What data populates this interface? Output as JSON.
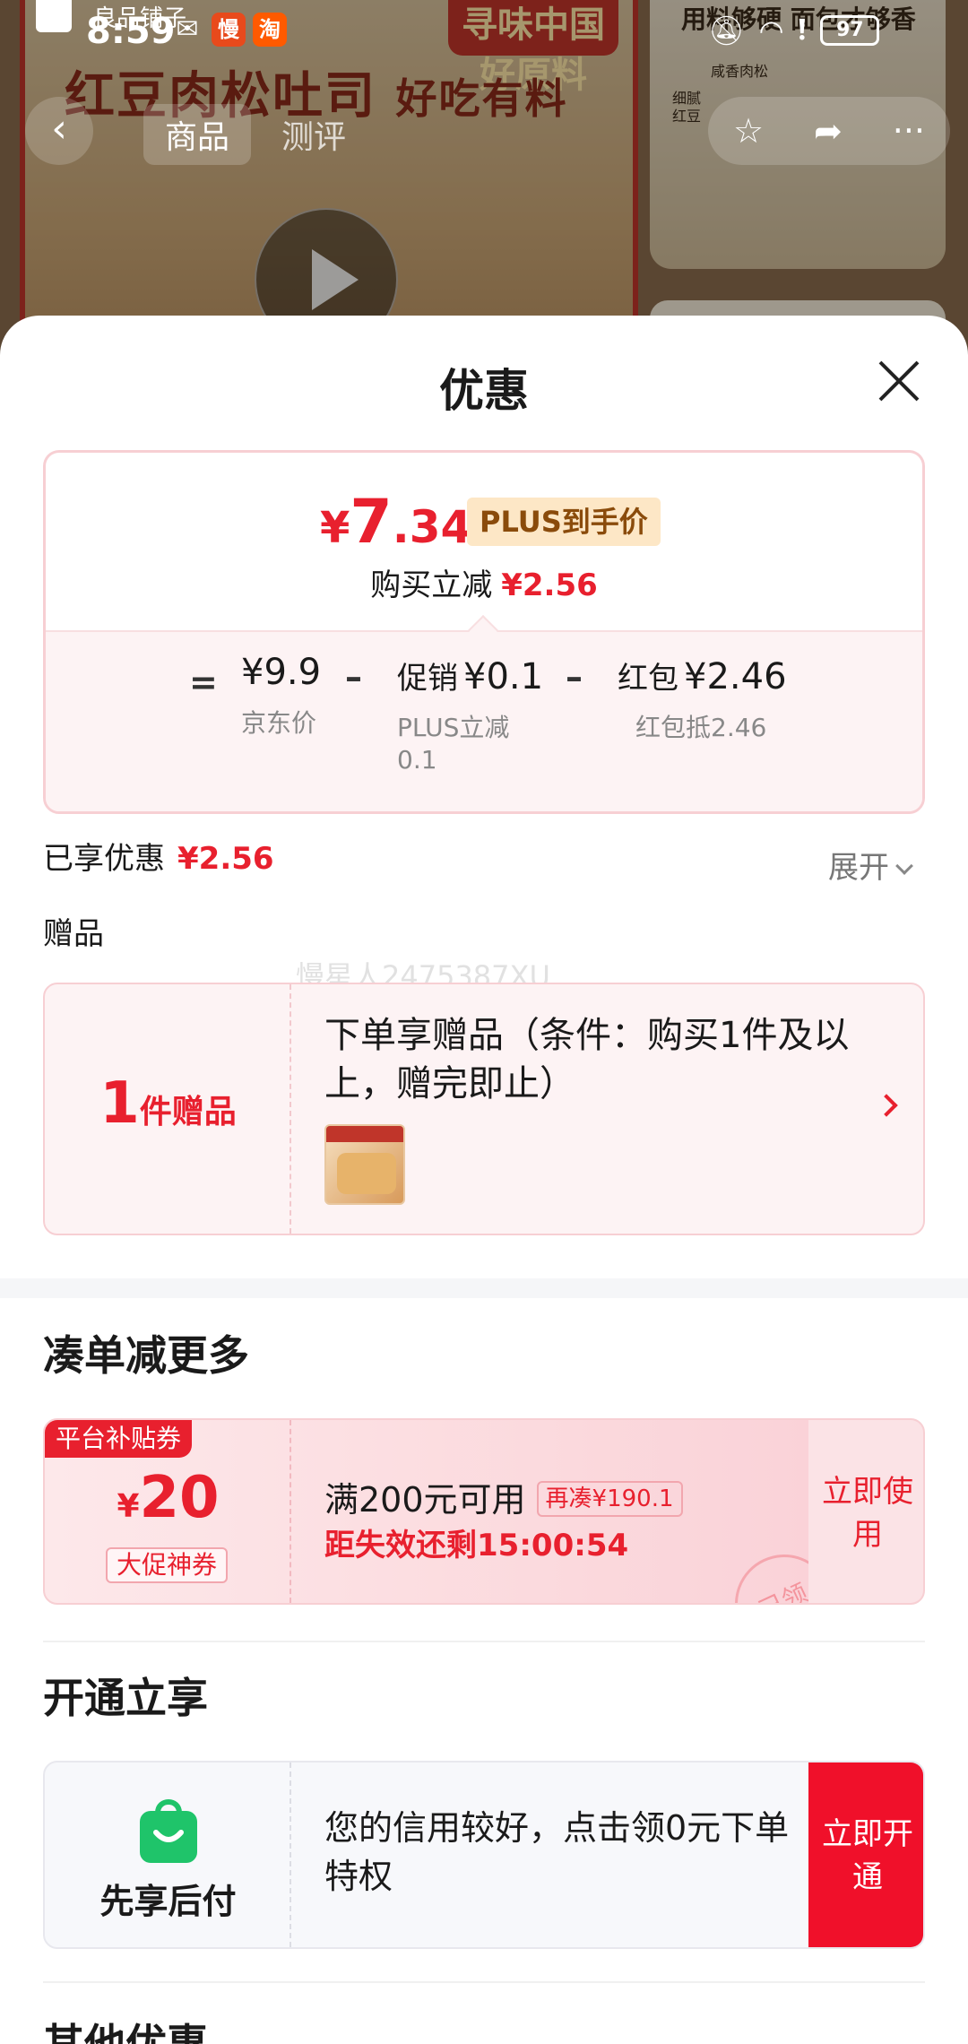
{
  "background": {
    "headline": "红豆肉松吐司",
    "headline_small": "好吃有料",
    "banner": "寻味中国好原料",
    "side_text": "用料够硬 面包才够香",
    "side_label_1": "咸香肉松",
    "side_label_2": "细腻红豆",
    "top_left_text": "良品铺子",
    "tabs": [
      {
        "label": "商品"
      },
      {
        "label": "测评"
      }
    ]
  },
  "status_bar": {
    "time": "8:59",
    "app_1": "慢",
    "app_2": "淘",
    "battery": "97"
  },
  "sheet": {
    "title": "优惠",
    "final_price_symbol": "¥",
    "final_price_int": "7",
    "final_price_dec": ".34",
    "plus_tag": "PLUS到手价",
    "reduce_label": "购买立减",
    "reduce_value": "¥2.56",
    "calc": {
      "equals": "=",
      "minus": "–",
      "jd_price": "¥9.9",
      "jd_price_label": "京东价",
      "promo_prefix": "促销",
      "promo_value": "¥0.1",
      "promo_label": "PLUS立减0.1",
      "redpack_prefix": "红包",
      "redpack_value": "¥2.46",
      "redpack_label": "红包抵2.46"
    },
    "enjoyed_label": "已享优惠",
    "enjoyed_value": "¥2.56",
    "expand_label": "展开",
    "gift_section": "赠品",
    "watermark": "慢星人2475387XU",
    "gift": {
      "count": "1",
      "count_unit": "件赠品",
      "text": "下单享赠品（条件：购买1件及以上，赠完即止）"
    },
    "coupon_section": "凑单减更多",
    "coupon": {
      "flag": "平台补贴券",
      "symbol": "¥",
      "amount": "20",
      "tag": "大促神券",
      "condition": "满200元可用",
      "again": "再凑¥190.1",
      "countdown": "距失效还剩15:00:54",
      "stamp": "已领",
      "button": "立即使用"
    },
    "bnpl_section": "开通立享",
    "bnpl": {
      "name": "先享后付",
      "text": "您的信用较好，点击领0元下单特权",
      "button": "立即开通"
    },
    "other_section": "其他优惠"
  },
  "colors": {
    "accent_red": "#e8202e",
    "bnpl_green": "#1fc46a"
  }
}
